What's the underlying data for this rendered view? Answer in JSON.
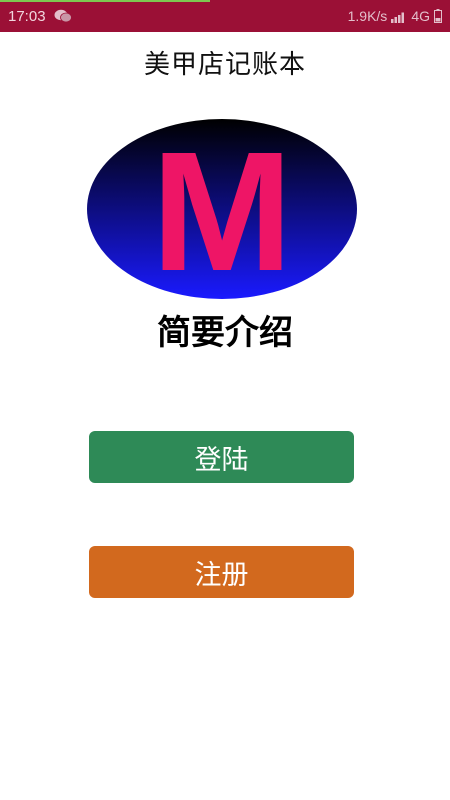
{
  "status_bar": {
    "time": "17:03",
    "net_speed": "1.9K/s",
    "network_type": "4G",
    "load_progress": 0.47,
    "icons": [
      "wechat-icon",
      "signal-icon",
      "battery-icon"
    ]
  },
  "app": {
    "title": "美甲店记账本",
    "logo_letter": "M",
    "intro_title": "简要介绍"
  },
  "buttons": {
    "login_label": "登陆",
    "register_label": "注册"
  },
  "colors": {
    "status_bar": "#9b1036",
    "logo_ellipse_top": "#000000",
    "logo_ellipse_bottom": "#1a1aff",
    "logo_letter": "#ee1566",
    "login_button": "#2e8a57",
    "register_button": "#d2691e"
  }
}
